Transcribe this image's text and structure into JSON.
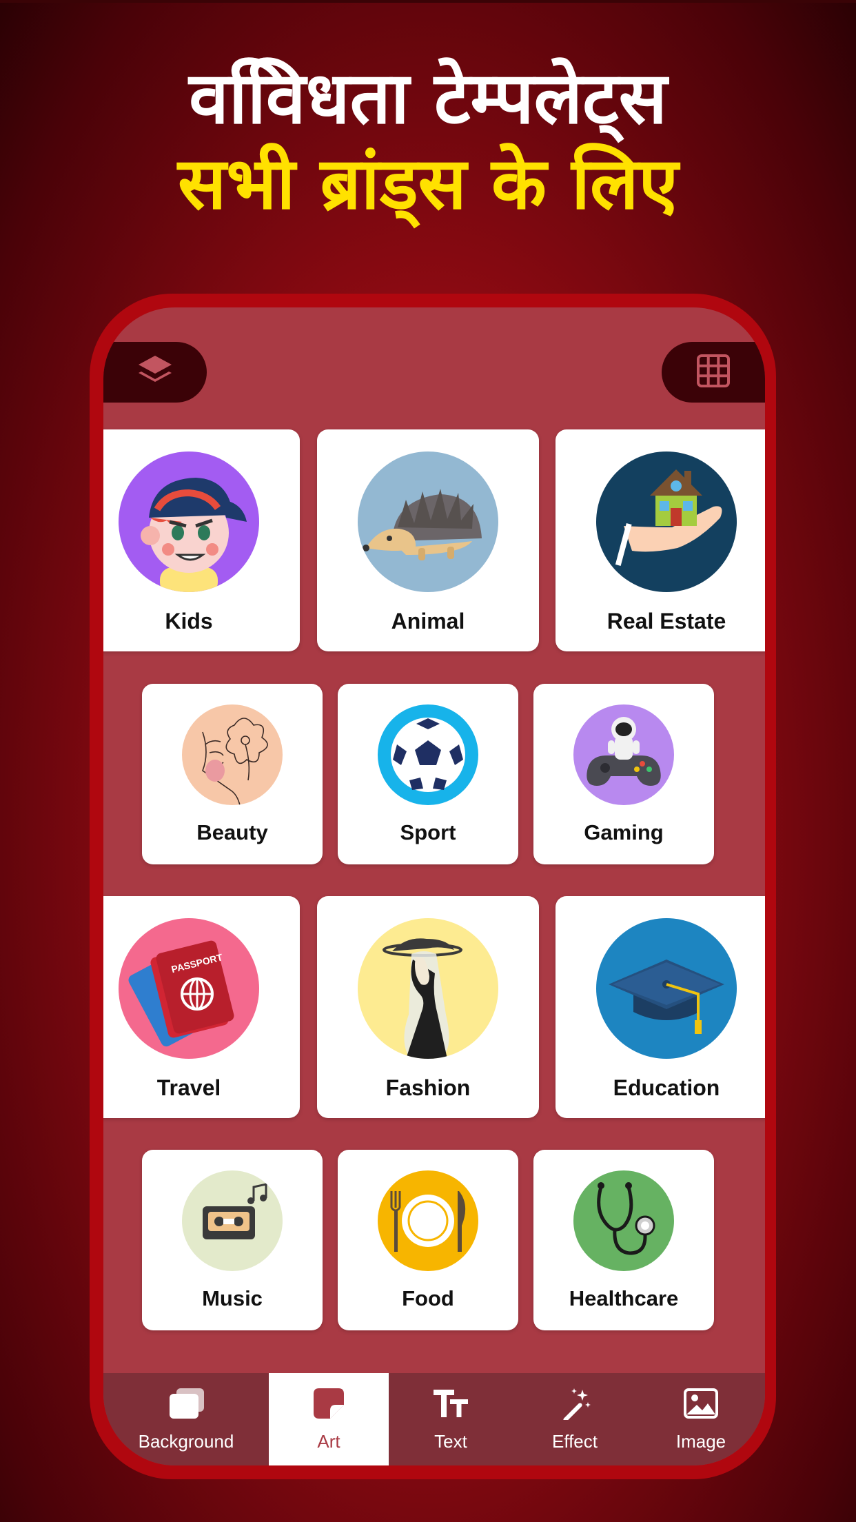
{
  "headline": {
    "line1": "ववििधता टेम्पलेट्स",
    "line2": "सभी ब्रांड्स के लिए"
  },
  "colors": {
    "accent_yellow": "#ffe100",
    "phone_frame": "#b0070f",
    "screen_bg": "#a93a44",
    "bottom_bar": "#7f2f38"
  },
  "toolbar": {
    "layers_icon": "layers-icon",
    "grid_icon": "grid-icon"
  },
  "categories": [
    {
      "label": "Kids",
      "icon": "kid-avatar-icon"
    },
    {
      "label": "Animal",
      "icon": "hedgehog-icon"
    },
    {
      "label": "Real Estate",
      "icon": "house-in-hand-icon"
    },
    {
      "label": "Beauty",
      "icon": "face-flower-icon"
    },
    {
      "label": "Sport",
      "icon": "soccer-ball-icon"
    },
    {
      "label": "Gaming",
      "icon": "astronaut-controller-icon"
    },
    {
      "label": "Travel",
      "icon": "passport-icon"
    },
    {
      "label": "Fashion",
      "icon": "woman-hat-icon"
    },
    {
      "label": "Education",
      "icon": "graduation-cap-icon"
    },
    {
      "label": "Music",
      "icon": "cassette-icon"
    },
    {
      "label": "Food",
      "icon": "plate-cutlery-icon"
    },
    {
      "label": "Healthcare",
      "icon": "stethoscope-icon"
    }
  ],
  "bottom_tabs": [
    {
      "label": "Background",
      "icon": "background-icon",
      "active": false
    },
    {
      "label": "Art",
      "icon": "sticker-icon",
      "active": true
    },
    {
      "label": "Text",
      "icon": "text-icon",
      "active": false
    },
    {
      "label": "Effect",
      "icon": "magic-wand-icon",
      "active": false
    },
    {
      "label": "Image",
      "icon": "image-icon",
      "active": false
    }
  ]
}
